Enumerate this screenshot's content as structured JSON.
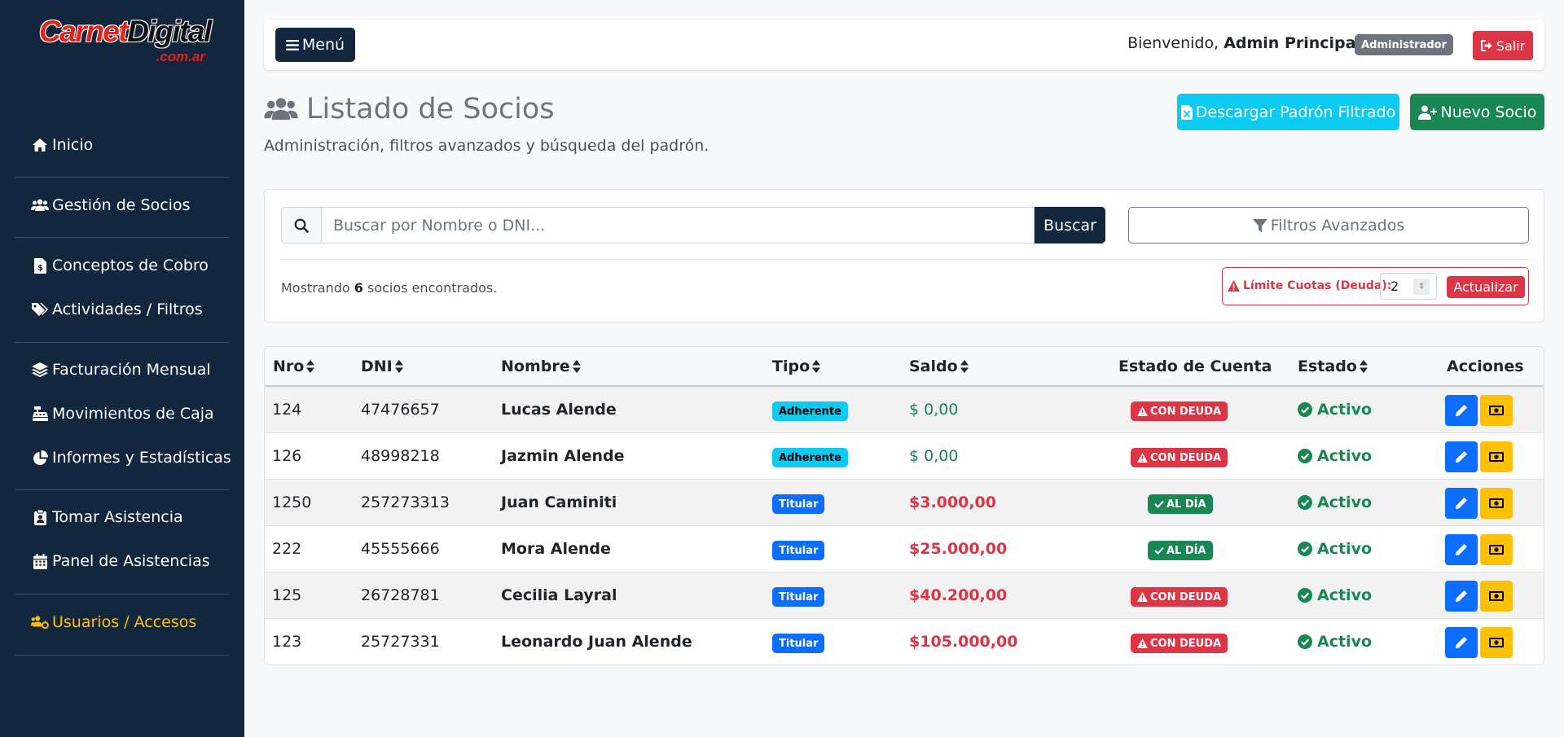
{
  "brand": {
    "part1": "Carnet",
    "part2": "Digital",
    "tld": ".com.ar"
  },
  "sidebar": {
    "items": [
      {
        "label": "Inicio",
        "icon": "home-icon"
      },
      {
        "label": "Gestión de Socios",
        "icon": "users-icon"
      },
      {
        "label": "Conceptos de Cobro",
        "icon": "invoice-icon"
      },
      {
        "label": "Actividades / Filtros",
        "icon": "tags-icon"
      },
      {
        "label": "Facturación Mensual",
        "icon": "layers-icon"
      },
      {
        "label": "Movimientos de Caja",
        "icon": "cash-register-icon"
      },
      {
        "label": "Informes y Estadísticas",
        "icon": "pie-chart-icon"
      },
      {
        "label": "Tomar Asistencia",
        "icon": "clipboard-user-icon"
      },
      {
        "label": "Panel de Asistencias",
        "icon": "calendar-icon"
      },
      {
        "label": "Usuarios / Accesos",
        "icon": "users-gear-icon"
      }
    ],
    "active_color": "#ffc107"
  },
  "topbar": {
    "menu_label": "Menú",
    "welcome_prefix": "Bienvenido,",
    "user_name": "Admin Principal",
    "role": "Administrador",
    "logout_label": "Salir"
  },
  "header": {
    "title": "Listado de Socios",
    "subtitle": "Administración, filtros avanzados y búsqueda del padrón.",
    "download_label": "Descargar Padrón Filtrado",
    "new_label": "Nuevo Socio"
  },
  "search": {
    "placeholder": "Buscar por Nombre o DNI...",
    "button": "Buscar",
    "filters_label": "Filtros Avanzados",
    "showing_prefix": "Mostrando",
    "showing_count": "6",
    "showing_suffix": "socios encontrados.",
    "limit_label": "Límite Cuotas (Deuda):",
    "limit_value": "2",
    "update_label": "Actualizar"
  },
  "table": {
    "headers": {
      "nro": "Nro",
      "dni": "DNI",
      "nombre": "Nombre",
      "tipo": "Tipo",
      "saldo": "Saldo",
      "estado_cuenta": "Estado de Cuenta",
      "estado": "Estado",
      "acciones": "Acciones"
    },
    "rows": [
      {
        "nro": "124",
        "dni": "47476657",
        "nombre": "Lucas Alende",
        "tipo": "Adherente",
        "saldo": "$ 0,00",
        "estado_cuenta": "CON DEUDA",
        "estado": "Activo"
      },
      {
        "nro": "126",
        "dni": "48998218",
        "nombre": "Jazmin Alende",
        "tipo": "Adherente",
        "saldo": "$ 0,00",
        "estado_cuenta": "CON DEUDA",
        "estado": "Activo"
      },
      {
        "nro": "1250",
        "dni": "257273313",
        "nombre": "Juan Caminiti",
        "tipo": "Titular",
        "saldo": "$3.000,00",
        "estado_cuenta": "AL DÍA",
        "estado": "Activo"
      },
      {
        "nro": "222",
        "dni": "45555666",
        "nombre": "Mora Alende",
        "tipo": "Titular",
        "saldo": "$25.000,00",
        "estado_cuenta": "AL DÍA",
        "estado": "Activo"
      },
      {
        "nro": "125",
        "dni": "26728781",
        "nombre": "Cecilia Layral",
        "tipo": "Titular",
        "saldo": "$40.200,00",
        "estado_cuenta": "CON DEUDA",
        "estado": "Activo"
      },
      {
        "nro": "123",
        "dni": "25727331",
        "nombre": "Leonardo Juan Alende",
        "tipo": "Titular",
        "saldo": "$105.000,00",
        "estado_cuenta": "CON DEUDA",
        "estado": "Activo"
      }
    ]
  },
  "colors": {
    "sidebar_bg": "#12263e",
    "danger": "#dc3545",
    "success": "#198754",
    "info": "#0dcaf0",
    "primary": "#0d6efd",
    "warning": "#ffc107"
  }
}
